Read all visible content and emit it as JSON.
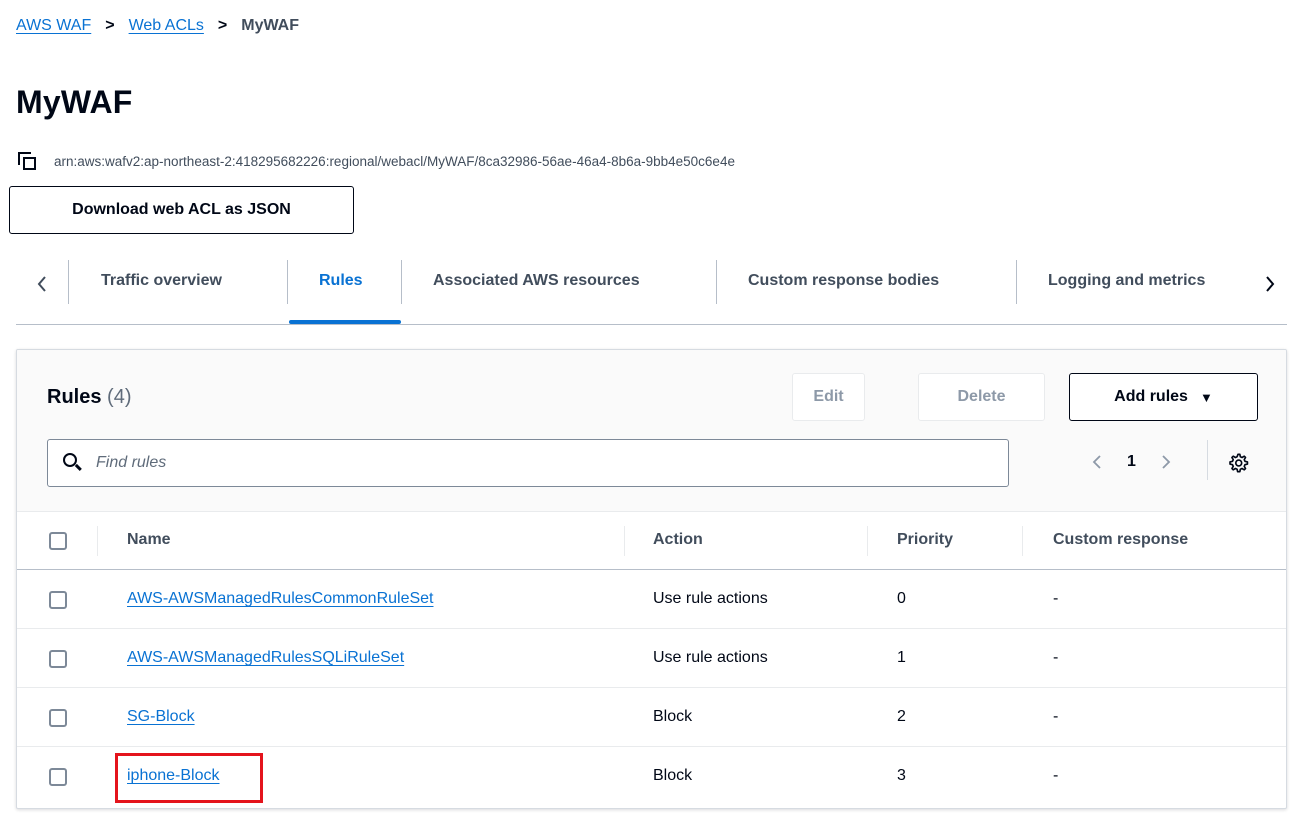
{
  "breadcrumb": {
    "items": [
      "AWS WAF",
      "Web ACLs"
    ],
    "current": "MyWAF"
  },
  "page_title": "MyWAF",
  "arn": "arn:aws:wafv2:ap-northeast-2:418295682226:regional/webacl/MyWAF/8ca32986-56ae-46a4-8b6a-9bb4e50c6e4e",
  "download_button": "Download web ACL as JSON",
  "tabs": [
    {
      "label": "Traffic overview"
    },
    {
      "label": "Rules",
      "active": true
    },
    {
      "label": "Associated AWS resources"
    },
    {
      "label": "Custom response bodies"
    },
    {
      "label": "Logging and metrics"
    }
  ],
  "rules_panel": {
    "title": "Rules",
    "count": "(4)",
    "edit_label": "Edit",
    "delete_label": "Delete",
    "add_label": "Add rules",
    "search_placeholder": "Find rules",
    "page": "1",
    "columns": [
      "Name",
      "Action",
      "Priority",
      "Custom response"
    ],
    "rows": [
      {
        "name": "AWS-AWSManagedRulesCommonRuleSet",
        "action": "Use rule actions",
        "priority": "0",
        "custom_response": "-"
      },
      {
        "name": "AWS-AWSManagedRulesSQLiRuleSet",
        "action": "Use rule actions",
        "priority": "1",
        "custom_response": "-"
      },
      {
        "name": "SG-Block",
        "action": "Block",
        "priority": "2",
        "custom_response": "-"
      },
      {
        "name": "iphone-Block",
        "action": "Block",
        "priority": "3",
        "custom_response": "-",
        "highlighted": true
      }
    ]
  },
  "colors": {
    "link": "#0972d3",
    "text": "#000716",
    "highlight_border": "#e4141c"
  }
}
